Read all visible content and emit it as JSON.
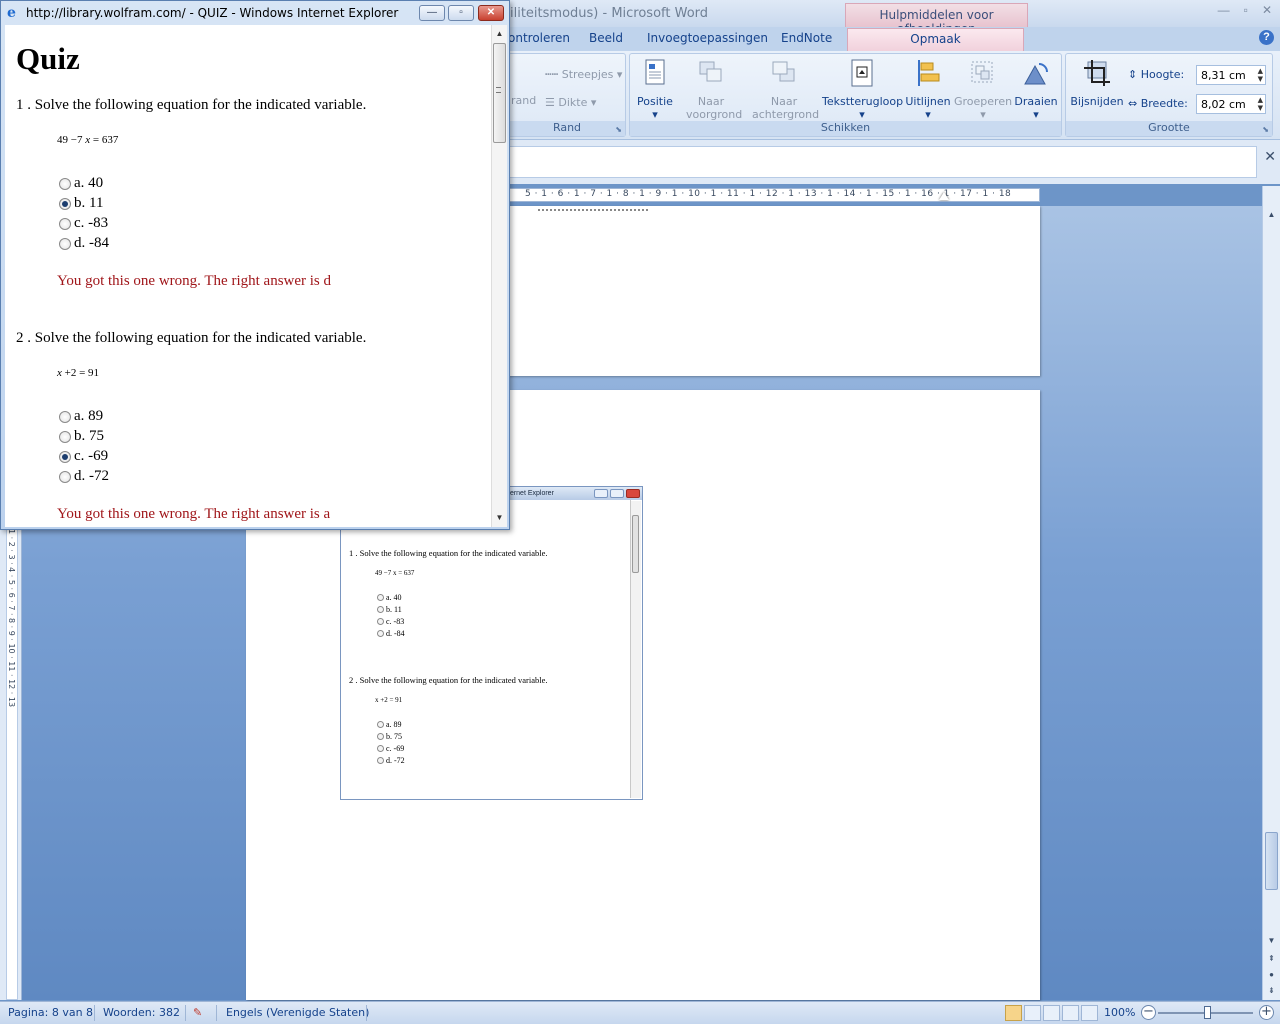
{
  "word": {
    "title": "(Compatibiliteitsmodus) - Microsoft Word",
    "title_visible": "iliteitsmodus) - Microsoft Word",
    "context_tab": "Hulpmiddelen voor afbeeldingen",
    "tabs": [
      "ontroleren",
      "Beeld",
      "Invoegtoepassingen",
      "EndNote",
      "Opmaak"
    ],
    "ribbon": {
      "rand_group": {
        "label": "Rand",
        "streepjes": "Streepjes",
        "dikte": "Dikte",
        "rand_partial": "rand"
      },
      "schikken_group": {
        "label": "Schikken",
        "buttons": [
          "Positie",
          "Naar voorgrond",
          "Naar achtergrond",
          "Tekstterugloop",
          "Uitlijnen",
          "Groeperen",
          "Draaien"
        ]
      },
      "grootte_group": {
        "label": "Grootte",
        "crop": "Bijsnijden",
        "height_label": "Hoogte:",
        "height_value": "8,31 cm",
        "width_label": "Breedte:",
        "width_value": "8,02 cm"
      }
    },
    "ruler_marks": "5 · 1 · 6 · 1 · 7 · 1 · 8 · 1 · 9 · 1 · 10 · 1 · 11 · 1 · 12 · 1 · 13 · 1 · 14 · 1 · 15 · 1 · 16 · 1 · 17 · 1 · 18",
    "vruler_marks": "1 · 2 · 3 · 4 · 5 · 6 · 7 · 8 · 9 · 10 · 11 · 12 · 13",
    "status": {
      "page": "Pagina: 8 van 8",
      "words": "Woorden: 382",
      "language": "Engels (Verenigde Staten)",
      "zoom": "100%"
    }
  },
  "embedded": {
    "title": "ternet Explorer",
    "q1": "1 . Solve the following equation for the indicated variable.",
    "q1_eq": "49 −7 x = 637",
    "q1_options": [
      "a. 40",
      "b. 11",
      "c. -83",
      "d. -84"
    ],
    "q2": "2 . Solve the following equation for the indicated variable.",
    "q2_eq": "x +2 = 91",
    "q2_options": [
      "a. 89",
      "b. 75",
      "c. -69",
      "d. -72"
    ]
  },
  "ie": {
    "title": "http://library.wolfram.com/ - QUIZ - Windows Internet Explorer",
    "heading": "Quiz",
    "questions": [
      {
        "text": "1 . Solve the following equation for the indicated variable.",
        "eq_a": "49 −7",
        "eq_var": "x",
        "eq_b": "= 637",
        "options": [
          "a. 40",
          "b. 11",
          "c. -83",
          "d. -84"
        ],
        "selected": 1,
        "feedback": "You got this one wrong. The right answer is d"
      },
      {
        "text": "2 . Solve the following equation for the indicated variable.",
        "eq_var": "x",
        "eq_b": "+2 = 91",
        "options": [
          "a. 89",
          "b. 75",
          "c. -69",
          "d. -72"
        ],
        "selected": 2,
        "feedback": "You got this one wrong. The right answer is a"
      }
    ]
  }
}
